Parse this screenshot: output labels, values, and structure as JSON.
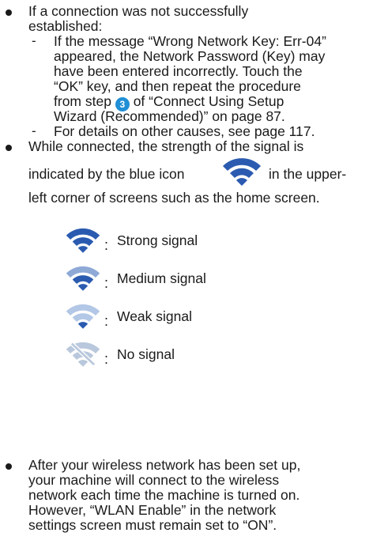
{
  "bullets": {
    "b1_line1": "If a connection was not successfully",
    "b1_line2": "established:",
    "sub1_line1": "If the message “Wrong Network Key: Err-04”",
    "sub1_line2": "appeared, the Network Password (Key) may",
    "sub1_line3": "have been entered incorrectly. Touch the",
    "sub1_line4": "“OK” key, and then repeat the procedure",
    "sub1_line5_pre": "from step",
    "sub1_step_num": "3",
    "sub1_line5_post": "of “Connect Using Setup",
    "sub1_line6": "Wizard (Recommended)” on page 87.",
    "sub2_line1": "For details on other causes, see page 117.",
    "b2_line1": "While connected, the strength of the signal is",
    "b2_line2_pre": "indicated by the blue icon",
    "b2_line2_post": "in the upper-",
    "b2_line3": "left corner of screens such as the home screen.",
    "b3_line1": "After your wireless network has been set up,",
    "b3_line2": "your machine will connect to the wireless",
    "b3_line3": "network each time the machine is turned on.",
    "b3_line4": "However, “WLAN Enable” in the network",
    "b3_line5": "settings screen must remain set to “ON”."
  },
  "legend": {
    "colon": ":",
    "strong": "Strong signal",
    "medium": "Medium signal",
    "weak": "Weak signal",
    "none": "No signal"
  },
  "icons": {
    "wifi_inline": "wifi-icon",
    "wifi_strong": "wifi-strong-icon",
    "wifi_medium": "wifi-medium-icon",
    "wifi_weak": "wifi-weak-icon",
    "wifi_none": "wifi-none-icon"
  },
  "colors": {
    "strong": "#2b5bb0",
    "medium": "#8ea9d6",
    "weak": "#b3c7e6",
    "none": "#b9c8dc",
    "step_circle": "#1f8fd6"
  }
}
